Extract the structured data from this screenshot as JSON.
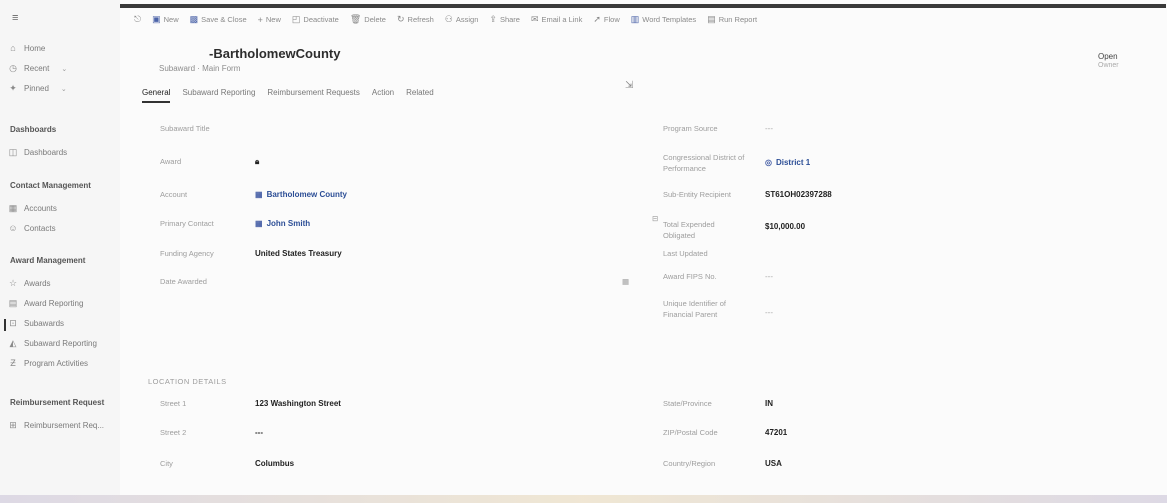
{
  "toolbar": {
    "items": [
      {
        "icon": "back-icon",
        "label": ""
      },
      {
        "icon": "new-icon",
        "label": "New"
      },
      {
        "icon": "save-close-icon",
        "label": "Save & Close"
      },
      {
        "icon": "new-plus-icon",
        "label": "New"
      },
      {
        "icon": "deactivate-icon",
        "label": "Deactivate"
      },
      {
        "icon": "delete-icon",
        "label": "Delete"
      },
      {
        "icon": "refresh-icon",
        "label": "Refresh"
      },
      {
        "icon": "assign-icon",
        "label": "Assign"
      },
      {
        "icon": "share-icon",
        "label": "Share"
      },
      {
        "icon": "email-link-icon",
        "label": "Email a Link"
      },
      {
        "icon": "flow-icon",
        "label": "Flow"
      },
      {
        "icon": "word-templates-icon",
        "label": "Word Templates"
      },
      {
        "icon": "run-report-icon",
        "label": "Run Report"
      }
    ]
  },
  "sidebar": {
    "top": [
      {
        "icon": "home-icon",
        "label": "Home"
      },
      {
        "icon": "recent-icon",
        "label": "Recent"
      },
      {
        "icon": "pinned-icon",
        "label": "Pinned"
      }
    ],
    "groups": [
      {
        "title": "Dashboards",
        "items": [
          {
            "icon": "dashboard-icon",
            "label": "Dashboards"
          }
        ]
      },
      {
        "title": "Contact Management",
        "items": [
          {
            "icon": "building-icon",
            "label": "Accounts"
          },
          {
            "icon": "person-icon",
            "label": "Contacts"
          }
        ]
      },
      {
        "title": "Award Management",
        "items": [
          {
            "icon": "award-icon",
            "label": "Awards"
          },
          {
            "icon": "report-icon",
            "label": "Award Reporting"
          },
          {
            "icon": "subaward-icon",
            "label": "Subawards"
          },
          {
            "icon": "subaward-report-icon",
            "label": "Subaward Reporting"
          },
          {
            "icon": "activity-icon",
            "label": "Program Activities"
          }
        ]
      },
      {
        "title": "Reimbursement Request",
        "items": [
          {
            "icon": "reimbursement-icon",
            "label": "Reimbursement Req..."
          }
        ]
      }
    ]
  },
  "header": {
    "title": "-BartholomewCounty",
    "subtitle": "Subaward · Main Form",
    "owner": "Open",
    "owner_sub": "Owner"
  },
  "tabs": [
    "General",
    "Subaward Reporting",
    "Reimbursement Requests",
    "Action",
    "Related"
  ],
  "left_fields": [
    {
      "label": "Subaward Title",
      "value": ""
    },
    {
      "label": "Award",
      "value": ""
    },
    {
      "label": "Account",
      "value": "Bartholomew County"
    },
    {
      "label": "Primary Contact",
      "value": "John Smith"
    },
    {
      "label": "Funding Agency",
      "value": "United States Treasury"
    },
    {
      "label": "Date Awarded",
      "value": ""
    }
  ],
  "right_fields": [
    {
      "label": "Program Source",
      "value": "---"
    },
    {
      "label": "Congressional District of Performance",
      "value": "District 1"
    },
    {
      "label": "Sub-Entity Recipient",
      "value": "ST61OH02397288"
    },
    {
      "label": "Total Expended Obligated",
      "value": "$10,000.00"
    },
    {
      "label": "Last Updated",
      "value": ""
    },
    {
      "label": "Award FIPS No.",
      "value": "---"
    },
    {
      "label": "Unique Identifier of Financial Parent",
      "value": "---"
    }
  ],
  "address_section": {
    "title": "LOCATION DETAILS",
    "left": [
      {
        "label": "Street 1",
        "value": "123 Washington Street"
      },
      {
        "label": "Street 2",
        "value": "---"
      },
      {
        "label": "City",
        "value": "Columbus"
      }
    ],
    "right": [
      {
        "label": "State/Province",
        "value": "IN"
      },
      {
        "label": "ZIP/Postal Code",
        "value": "47201"
      },
      {
        "label": "Country/Region",
        "value": "USA"
      }
    ]
  }
}
